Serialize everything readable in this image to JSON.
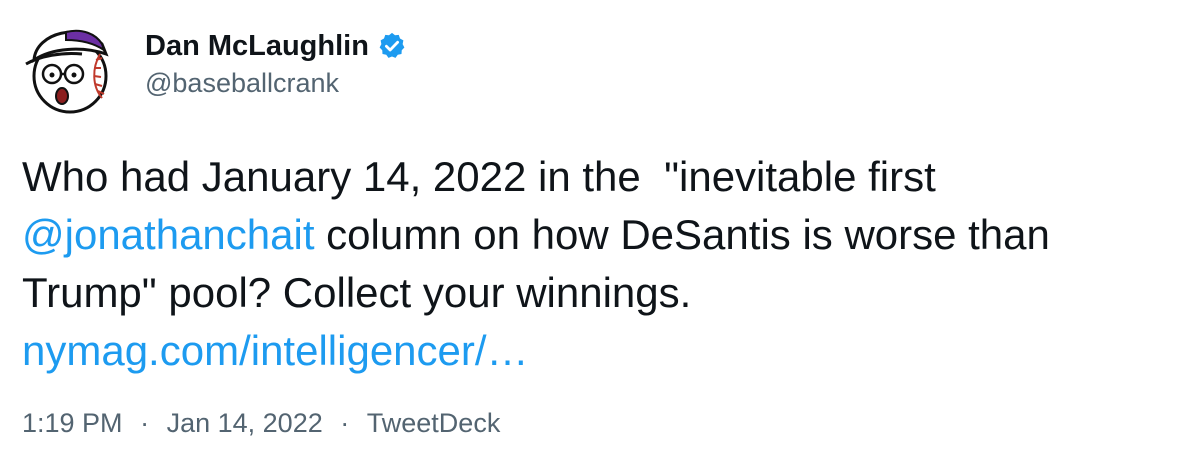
{
  "user": {
    "display_name": "Dan McLaughlin",
    "handle": "@baseballcrank",
    "verified_icon": "verified-badge-icon"
  },
  "tweet": {
    "line1": "Who had January 14, 2022 in the  \"inevitable first",
    "mention": "@jonathanchait",
    "line2_rest": " column on how DeSantis is worse than",
    "line3": "Trump\" pool? Collect your winnings.",
    "link": "nymag.com/intelligencer/…"
  },
  "meta": {
    "time": "1:19 PM",
    "sep1": "·",
    "date": "Jan 14, 2022",
    "sep2": "·",
    "source": "TweetDeck"
  },
  "colors": {
    "link": "#1d9bf0",
    "text": "#0f1419",
    "muted": "#536471",
    "avatar_cap": "#6b2fa3"
  }
}
